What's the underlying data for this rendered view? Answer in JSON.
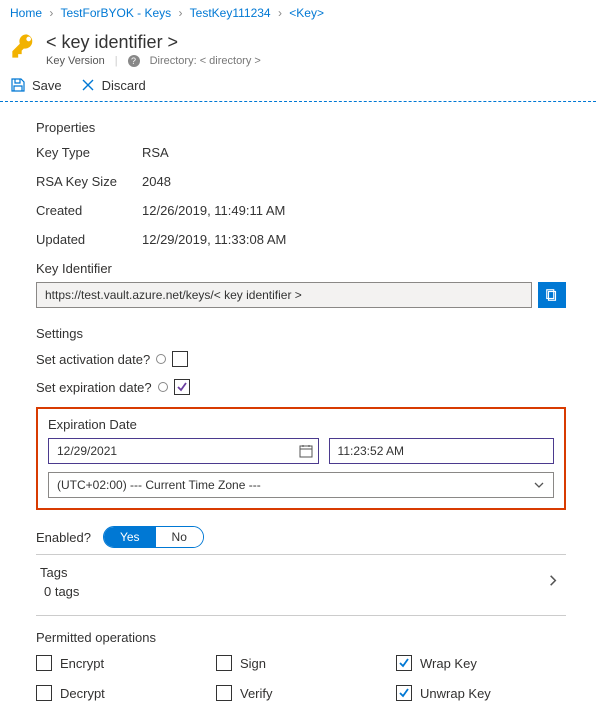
{
  "breadcrumb": {
    "items": [
      "Home",
      "TestForBYOK - Keys",
      "TestKey111234",
      "<Key>"
    ]
  },
  "header": {
    "title": "< key identifier >",
    "subtitle": "Key Version",
    "directory_label": "Directory:",
    "directory_value": "< directory >"
  },
  "toolbar": {
    "save_label": "Save",
    "discard_label": "Discard"
  },
  "properties": {
    "heading": "Properties",
    "key_type_label": "Key Type",
    "key_type_value": "RSA",
    "rsa_size_label": "RSA Key Size",
    "rsa_size_value": "2048",
    "created_label": "Created",
    "created_value": "12/26/2019, 11:49:11 AM",
    "updated_label": "Updated",
    "updated_value": "12/29/2019, 11:33:08 AM",
    "identifier_label": "Key Identifier",
    "identifier_value": "https://test.vault.azure.net/keys/< key identifier >"
  },
  "settings": {
    "heading": "Settings",
    "activation_label": "Set activation date?",
    "expiration_label": "Set expiration date?",
    "expiration_date_heading": "Expiration Date",
    "date_value": "12/29/2021",
    "time_value": "11:23:52 AM",
    "timezone_value": "(UTC+02:00) --- Current Time Zone ---",
    "enabled_label": "Enabled?",
    "enabled_yes": "Yes",
    "enabled_no": "No"
  },
  "tags": {
    "heading": "Tags",
    "count_text": "0 tags"
  },
  "operations": {
    "heading": "Permitted operations",
    "items": [
      {
        "label": "Encrypt",
        "checked": false
      },
      {
        "label": "Sign",
        "checked": false
      },
      {
        "label": "Wrap Key",
        "checked": true
      },
      {
        "label": "Decrypt",
        "checked": false
      },
      {
        "label": "Verify",
        "checked": false
      },
      {
        "label": "Unwrap Key",
        "checked": true
      }
    ]
  }
}
